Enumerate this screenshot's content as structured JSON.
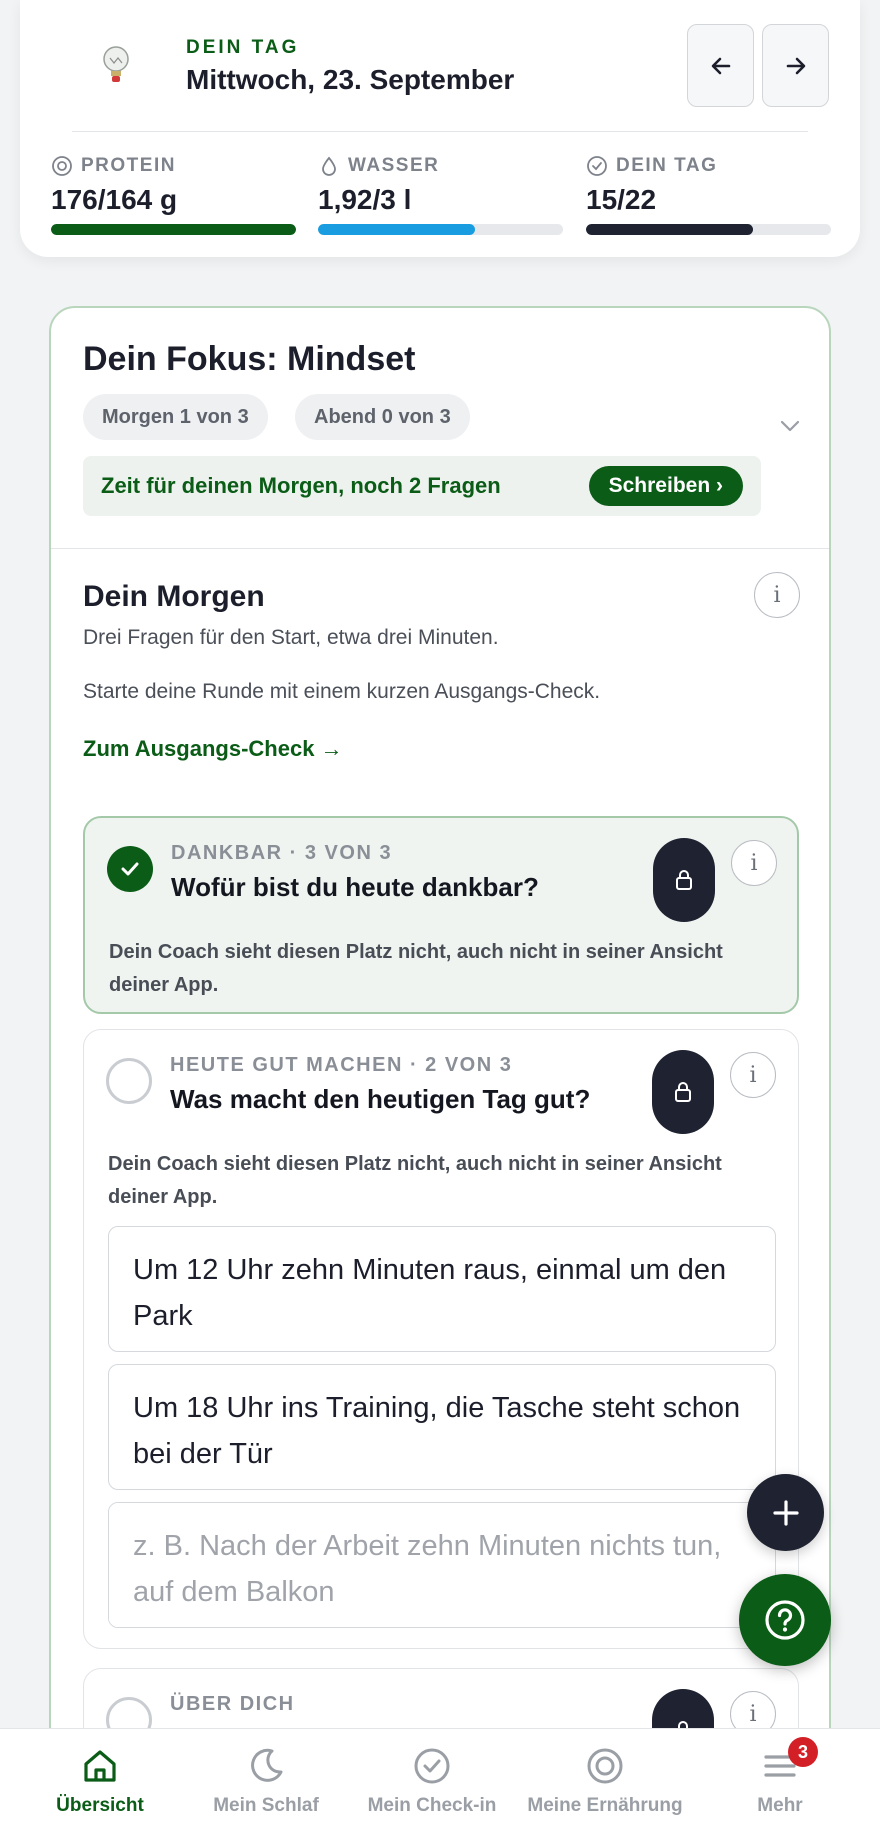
{
  "header": {
    "eyebrow": "DEIN TAG",
    "title": "Mittwoch, 23. September",
    "prev_label": "←",
    "next_label": "→",
    "metrics": [
      {
        "label": "PROTEIN",
        "value": "176/164 g",
        "progress": 1.0,
        "color": "#0a5c16",
        "icon": "target-icon"
      },
      {
        "label": "WASSER",
        "value": "1,92/3 l",
        "progress": 0.64,
        "color": "#1a9de0",
        "icon": "water-drop-icon"
      },
      {
        "label": "DEIN TAG",
        "value": "15/22",
        "progress": 0.68,
        "color": "#1f2231",
        "icon": "check-circle-icon"
      }
    ]
  },
  "focus": {
    "title": "Dein Fokus: Mindset",
    "pills": [
      "Morgen 1 von 3",
      "Abend 0 von 3"
    ],
    "prompt": "Zeit für deinen Morgen, noch 2 Fragen",
    "write_label": "Schreiben ›"
  },
  "morning": {
    "title": "Dein Morgen",
    "subtitle": "Drei Fragen für den Start, etwa drei Minuten.",
    "description": "Starte deine Runde mit einem kurzen Ausgangs-Check.",
    "link": "Zum Ausgangs-Check →",
    "info": "i"
  },
  "questions": [
    {
      "category": "DANKBAR · 3 VON 3",
      "text": "Wofür bist du heute dankbar?",
      "note": "Dein Coach sieht diesen Platz nicht, auch nicht in seiner Ansicht deiner App.",
      "done": true
    },
    {
      "category": "HEUTE GUT MACHEN · 2 VON 3",
      "text": "Was macht den heutigen Tag gut?",
      "note": "Dein Coach sieht diesen Platz nicht, auch nicht in seiner Ansicht deiner App.",
      "done": false,
      "answers": [
        "Um 12 Uhr zehn Minuten raus, einmal um den Park",
        "Um 18 Uhr ins Training, die Tasche steht schon bei der Tür"
      ],
      "placeholder": "z. B. Nach der Arbeit zehn Minuten nichts tun, auf dem Balkon"
    },
    {
      "category": "ÜBER DICH",
      "done": false
    }
  ],
  "nav": {
    "items": [
      "Übersicht",
      "Mein Schlaf",
      "Mein Check-in",
      "Meine Ernährung",
      "Mehr"
    ],
    "badge": "3"
  },
  "colors": {
    "brand": "#0a5c16",
    "dark": "#1f2231",
    "water": "#1a9de0",
    "badge": "#d32027"
  }
}
